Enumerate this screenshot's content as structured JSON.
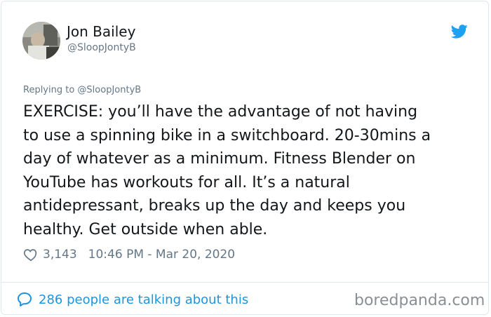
{
  "tweet": {
    "author_name": "Jon Bailey",
    "author_handle": "@SloopJontyB",
    "replying_to": "Replying to @SloopJontyB",
    "text": "EXERCISE: you’ll have the advantage of not having\nto use a spinning bike in a switchboard. 20-30mins a\nday of whatever as a minimum. Fitness Blender on\nYouTube has workouts for all. It’s a natural\nantidepressant, breaks up the day and keeps you\nhealthy. Get outside when able.",
    "like_count": "3,143",
    "timestamp": "10:46 PM - Mar 20, 2020",
    "talking_text": "286 people are talking about this"
  },
  "watermark": "boredpanda.com",
  "icons": {
    "brand": "twitter-bird-icon",
    "like": "heart-icon",
    "conversation": "speech-bubble-icon"
  },
  "colors": {
    "link_blue": "#1b95e0",
    "bird_blue": "#1da1f2",
    "secondary_text": "#657786",
    "primary_text": "#14171a",
    "border": "#e1e8ed"
  }
}
